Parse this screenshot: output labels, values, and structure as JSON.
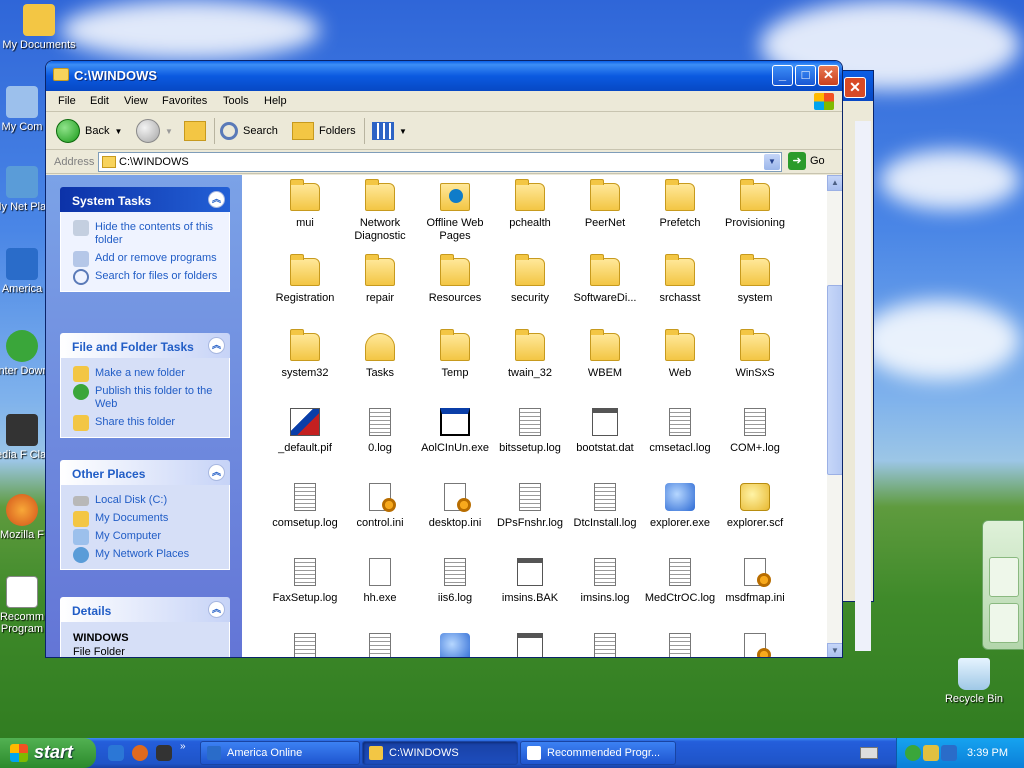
{
  "desktop": {
    "icons": [
      {
        "label": "My Documents"
      },
      {
        "label": "My Com"
      },
      {
        "label": "My Net Plac"
      },
      {
        "label": "America"
      },
      {
        "label": "Inter Down"
      },
      {
        "label": "Media F Class"
      },
      {
        "label": "Mozilla F"
      },
      {
        "label": "Recomm Program"
      },
      {
        "label": "Recycle Bin"
      }
    ]
  },
  "window": {
    "title": "C:\\WINDOWS",
    "buttons": {
      "minimize": "_",
      "maximize": "□",
      "close": "✕"
    }
  },
  "menu": [
    "File",
    "Edit",
    "View",
    "Favorites",
    "Tools",
    "Help"
  ],
  "toolbar": {
    "back": "Back",
    "search": "Search",
    "folders": "Folders"
  },
  "address": {
    "label": "Address",
    "value": "C:\\WINDOWS",
    "go": "Go"
  },
  "taskpane": {
    "system": {
      "title": "System Tasks",
      "links": [
        "Hide the contents of this folder",
        "Add or remove programs",
        "Search for files or folders"
      ]
    },
    "filefolder": {
      "title": "File and Folder Tasks",
      "links": [
        "Make a new folder",
        "Publish this folder to the Web",
        "Share this folder"
      ]
    },
    "other": {
      "title": "Other Places",
      "links": [
        "Local Disk (C:)",
        "My Documents",
        "My Computer",
        "My Network Places"
      ]
    },
    "details": {
      "title": "Details",
      "name": "WINDOWS",
      "type": "File Folder"
    }
  },
  "files": [
    {
      "name": "mui",
      "kind": "folder"
    },
    {
      "name": "Network Diagnostic",
      "kind": "folder"
    },
    {
      "name": "Offline Web Pages",
      "kind": "special"
    },
    {
      "name": "pchealth",
      "kind": "folder"
    },
    {
      "name": "PeerNet",
      "kind": "folder"
    },
    {
      "name": "Prefetch",
      "kind": "folder"
    },
    {
      "name": "Provisioning",
      "kind": "folder"
    },
    {
      "name": "Registration",
      "kind": "folder"
    },
    {
      "name": "repair",
      "kind": "folder"
    },
    {
      "name": "Resources",
      "kind": "folder"
    },
    {
      "name": "security",
      "kind": "folder"
    },
    {
      "name": "SoftwareDi...",
      "kind": "folder"
    },
    {
      "name": "srchasst",
      "kind": "folder"
    },
    {
      "name": "system",
      "kind": "folder"
    },
    {
      "name": "system32",
      "kind": "folder"
    },
    {
      "name": "Tasks",
      "kind": "tasks"
    },
    {
      "name": "Temp",
      "kind": "folder"
    },
    {
      "name": "twain_32",
      "kind": "folder"
    },
    {
      "name": "WBEM",
      "kind": "folder"
    },
    {
      "name": "Web",
      "kind": "folder"
    },
    {
      "name": "WinSxS",
      "kind": "folder"
    },
    {
      "name": "_default.pif",
      "kind": "pif"
    },
    {
      "name": "0.log",
      "kind": "doc"
    },
    {
      "name": "AolCInUn.exe",
      "kind": "app"
    },
    {
      "name": "bitssetup.log",
      "kind": "doc"
    },
    {
      "name": "bootstat.dat",
      "kind": "dat"
    },
    {
      "name": "cmsetacl.log",
      "kind": "doc"
    },
    {
      "name": "COM+.log",
      "kind": "doc"
    },
    {
      "name": "comsetup.log",
      "kind": "doc"
    },
    {
      "name": "control.ini",
      "kind": "ini"
    },
    {
      "name": "desktop.ini",
      "kind": "ini"
    },
    {
      "name": "DPsFnshr.log",
      "kind": "doc"
    },
    {
      "name": "DtcInstall.log",
      "kind": "doc"
    },
    {
      "name": "explorer.exe",
      "kind": "exe"
    },
    {
      "name": "explorer.scf",
      "kind": "scf"
    },
    {
      "name": "FaxSetup.log",
      "kind": "doc"
    },
    {
      "name": "hh.exe",
      "kind": "help"
    },
    {
      "name": "iis6.log",
      "kind": "doc"
    },
    {
      "name": "imsins.BAK",
      "kind": "dat"
    },
    {
      "name": "imsins.log",
      "kind": "doc"
    },
    {
      "name": "MedCtrOC.log",
      "kind": "doc"
    },
    {
      "name": "msdfmap.ini",
      "kind": "ini"
    },
    {
      "name": "",
      "kind": "doc"
    },
    {
      "name": "",
      "kind": "doc"
    },
    {
      "name": "",
      "kind": "exe"
    },
    {
      "name": "",
      "kind": "dat"
    },
    {
      "name": "",
      "kind": "doc"
    },
    {
      "name": "",
      "kind": "doc"
    },
    {
      "name": "",
      "kind": "ini"
    }
  ],
  "taskbar": {
    "start": "start",
    "tasks": [
      "America Online",
      "C:\\WINDOWS",
      "Recommended Progr..."
    ],
    "clock": "3:39 PM"
  }
}
